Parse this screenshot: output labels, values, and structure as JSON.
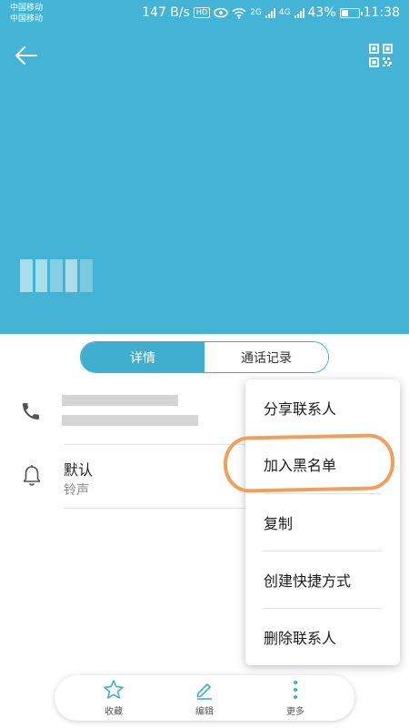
{
  "status_bar": {
    "carrier_1": "中国移动",
    "carrier_2": "中国移动",
    "speed": "147 B/s",
    "hd": "HD",
    "net_1": "2G",
    "net_2": "4G",
    "battery": "43%",
    "battery_level": 0.43,
    "time": "11:38"
  },
  "tabs": {
    "details": "详情",
    "call_log": "通话记录"
  },
  "ringtone": {
    "title": "默认",
    "subtitle": "铃声"
  },
  "menu": {
    "items": [
      "分享联系人",
      "加入黑名单",
      "复制",
      "创建快捷方式",
      "删除联系人"
    ]
  },
  "bottom_bar": {
    "favorite": "收藏",
    "edit": "编辑",
    "more": "更多"
  },
  "colors": {
    "header": "#44b4d6",
    "accent": "#40afcf",
    "annotation": "#f09a50"
  }
}
